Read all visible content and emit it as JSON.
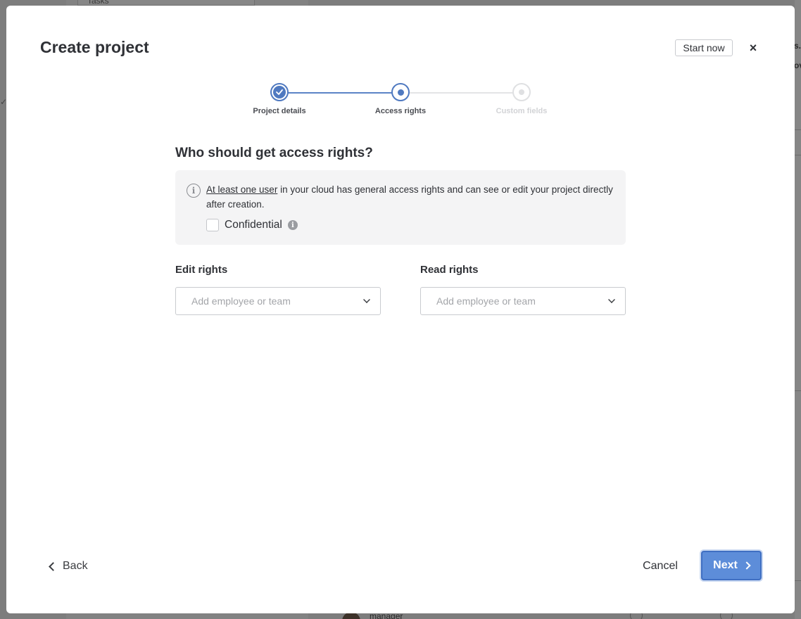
{
  "background": {
    "card_text": "Tasks",
    "bottom_text": "manager",
    "right_text_1": "s.",
    "right_text_2": "ov"
  },
  "modal": {
    "title": "Create project",
    "start_now": "Start now",
    "close_glyph": "×"
  },
  "stepper": {
    "steps": [
      {
        "label": "Project details",
        "state": "done"
      },
      {
        "label": "Access rights",
        "state": "active"
      },
      {
        "label": "Custom fields",
        "state": "todo"
      }
    ]
  },
  "access": {
    "title": "Who should get access rights?",
    "info_link": "At least one user",
    "info_text": " in your cloud has general access rights and can see or edit your project directly after creation.",
    "confidential_label": "Confidential",
    "confidential_checked": false
  },
  "fields": {
    "edit_label": "Edit rights",
    "edit_placeholder": "Add employee or team",
    "read_label": "Read rights",
    "read_placeholder": "Add employee or team"
  },
  "footer": {
    "back": "Back",
    "cancel": "Cancel",
    "next": "Next"
  },
  "colors": {
    "accent": "#4f79c0",
    "next_button": "#5d8dd9",
    "info_bg": "#f4f4f5"
  }
}
